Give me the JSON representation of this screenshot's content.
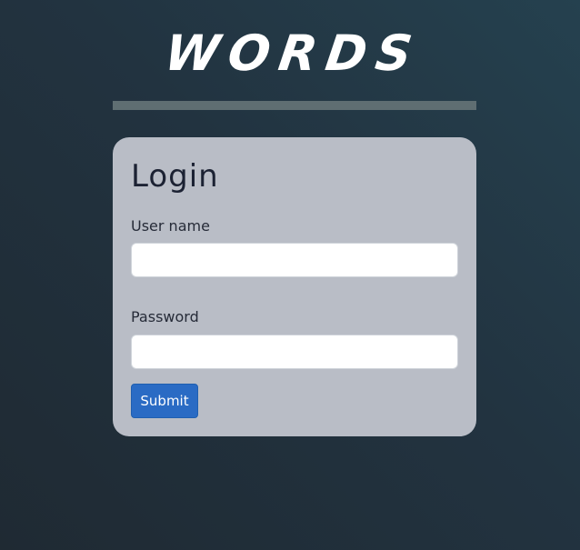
{
  "header": {
    "logo_text": "WORDS"
  },
  "login_form": {
    "title": "Login",
    "username": {
      "label": "User name",
      "value": ""
    },
    "password": {
      "label": "Password",
      "value": ""
    },
    "submit_label": "Submit"
  },
  "colors": {
    "background_start": "#25414f",
    "background_end": "#1f2a33",
    "divider": "#5f6e72",
    "card_background": "#b9bdc6",
    "button_primary": "#2a6bc4"
  }
}
